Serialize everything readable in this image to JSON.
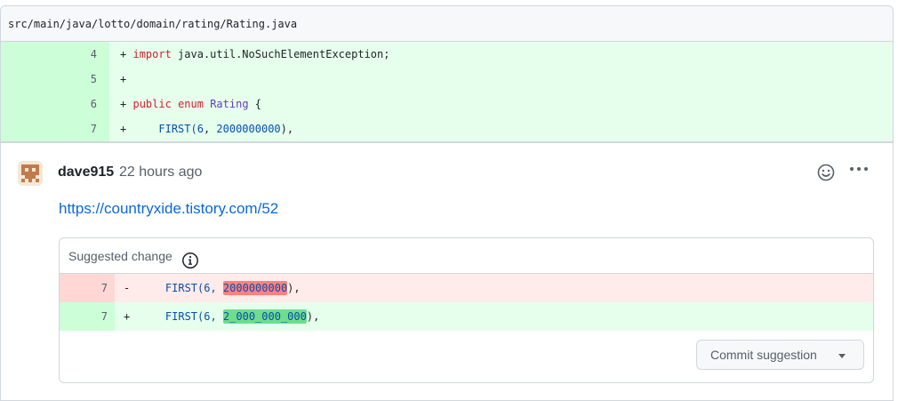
{
  "file": {
    "path": "src/main/java/lotto/domain/rating/Rating.java"
  },
  "diff_lines": [
    {
      "num": "4",
      "sign": "+",
      "tokens": [
        {
          "t": "import",
          "c": "kw"
        },
        {
          "t": " java.util.NoSuchElementException;",
          "c": ""
        }
      ]
    },
    {
      "num": "5",
      "sign": "+",
      "tokens": []
    },
    {
      "num": "6",
      "sign": "+",
      "tokens": [
        {
          "t": "public",
          "c": "kw"
        },
        {
          "t": " ",
          "c": ""
        },
        {
          "t": "enum",
          "c": "kw"
        },
        {
          "t": " ",
          "c": ""
        },
        {
          "t": "Rating",
          "c": "ty"
        },
        {
          "t": " {",
          "c": ""
        }
      ]
    },
    {
      "num": "7",
      "sign": "+",
      "tokens": [
        {
          "t": "    FIRST(",
          "c": "cn"
        },
        {
          "t": "6",
          "c": "cn"
        },
        {
          "t": ", ",
          "c": ""
        },
        {
          "t": "2000000000",
          "c": "cn"
        },
        {
          "t": "),",
          "c": ""
        }
      ]
    }
  ],
  "comment": {
    "author": "dave915",
    "time": "22 hours ago",
    "link": "https://countryxide.tistory.com/52",
    "emoji_icon": "smiley-icon",
    "more_icon": "kebab-horizontal-icon"
  },
  "suggestion": {
    "title": "Suggested change",
    "info_icon": "info-icon",
    "removed": {
      "num": "7",
      "sign": "-",
      "prefix": "    FIRST(6, ",
      "highlight": "2000000000",
      "suffix": "),"
    },
    "added": {
      "num": "7",
      "sign": "+",
      "prefix": "    FIRST(6, ",
      "highlight": "2_000_000_000",
      "suffix": "),"
    },
    "commit_label": "Commit suggestion"
  },
  "colors": {
    "add_bg": "#e6ffec",
    "add_num_bg": "#ccffd8",
    "del_bg": "#ffebe9",
    "del_num_bg": "#ffd7d5",
    "link": "#0969da"
  }
}
